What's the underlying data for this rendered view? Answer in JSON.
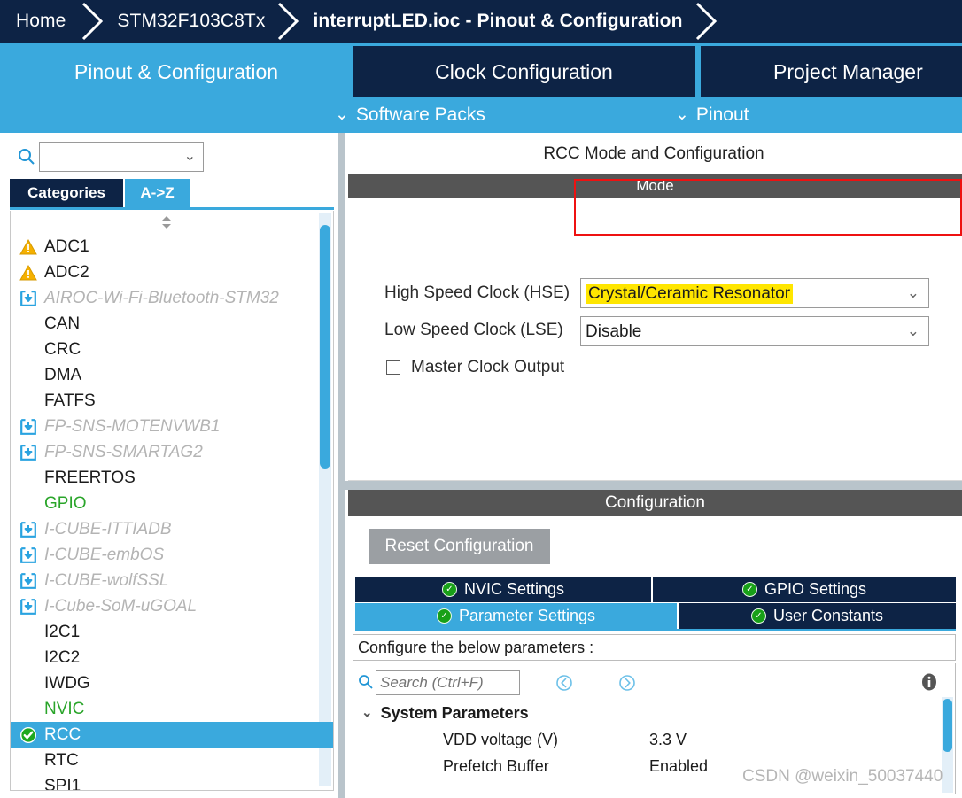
{
  "breadcrumb": {
    "items": [
      {
        "label": "Home",
        "active": false
      },
      {
        "label": "STM32F103C8Tx",
        "active": false
      },
      {
        "label": "interruptLED.ioc - Pinout & Configuration",
        "active": true
      }
    ]
  },
  "main_tabs": [
    {
      "label": "Pinout & Configuration",
      "active": true
    },
    {
      "label": "Clock Configuration",
      "active": false
    },
    {
      "label": "Project Manager",
      "active": false
    }
  ],
  "sub_toolbar": {
    "software_packs": "Software Packs",
    "pinout": "Pinout",
    "chevron_glyph": "⌄"
  },
  "left_panel": {
    "search": {
      "value": "",
      "placeholder": ""
    },
    "tabs": [
      {
        "label": "Categories",
        "active": false
      },
      {
        "label": "A->Z",
        "active": true
      }
    ],
    "items": [
      {
        "label": "ADC1",
        "icon": "warning-icon",
        "state": "warning"
      },
      {
        "label": "ADC2",
        "icon": "warning-icon",
        "state": "warning"
      },
      {
        "label": "AIROC-Wi-Fi-Bluetooth-STM32",
        "icon": "download-icon",
        "state": "dim"
      },
      {
        "label": "CAN",
        "icon": "none",
        "state": "normal"
      },
      {
        "label": "CRC",
        "icon": "none",
        "state": "normal"
      },
      {
        "label": "DMA",
        "icon": "none",
        "state": "normal"
      },
      {
        "label": "FATFS",
        "icon": "none",
        "state": "normal"
      },
      {
        "label": "FP-SNS-MOTENVWB1",
        "icon": "download-icon",
        "state": "dim"
      },
      {
        "label": "FP-SNS-SMARTAG2",
        "icon": "download-icon",
        "state": "dim"
      },
      {
        "label": "FREERTOS",
        "icon": "none",
        "state": "normal"
      },
      {
        "label": "GPIO",
        "icon": "none",
        "state": "green"
      },
      {
        "label": "I-CUBE-ITTIADB",
        "icon": "download-icon",
        "state": "dim"
      },
      {
        "label": "I-CUBE-embOS",
        "icon": "download-icon",
        "state": "dim"
      },
      {
        "label": "I-CUBE-wolfSSL",
        "icon": "download-icon",
        "state": "dim"
      },
      {
        "label": "I-Cube-SoM-uGOAL",
        "icon": "download-icon",
        "state": "dim"
      },
      {
        "label": "I2C1",
        "icon": "none",
        "state": "normal"
      },
      {
        "label": "I2C2",
        "icon": "none",
        "state": "normal"
      },
      {
        "label": "IWDG",
        "icon": "none",
        "state": "normal"
      },
      {
        "label": "NVIC",
        "icon": "none",
        "state": "green"
      },
      {
        "label": "RCC",
        "icon": "check-icon",
        "state": "selected"
      },
      {
        "label": "RTC",
        "icon": "none",
        "state": "normal"
      },
      {
        "label": "SPI1",
        "icon": "none",
        "state": "normal"
      }
    ]
  },
  "right_panel": {
    "page_title": "RCC Mode and Configuration",
    "mode": {
      "band_label": "Mode",
      "fields": [
        {
          "label": "High Speed Clock (HSE)",
          "value": "Crystal/Ceramic Resonator",
          "highlighted": true
        },
        {
          "label": "Low Speed Clock (LSE)",
          "value": "Disable",
          "highlighted": false
        }
      ],
      "checkbox": {
        "label": "Master Clock Output",
        "checked": false
      },
      "chevron_glyph": "⌄"
    },
    "configuration": {
      "band_label": "Configuration",
      "reset_button": "Reset Configuration",
      "tabs": [
        {
          "label": "NVIC Settings",
          "active": false
        },
        {
          "label": "GPIO Settings",
          "active": false
        },
        {
          "label": "Parameter Settings",
          "active": true
        },
        {
          "label": "User Constants",
          "active": false
        }
      ],
      "note": "Configure the below parameters :",
      "search": {
        "value": "",
        "placeholder": "Search (Ctrl+F)"
      },
      "group": {
        "label": "System Parameters",
        "expanded": true
      },
      "rows": [
        {
          "key": "VDD voltage (V)",
          "value": "3.3 V"
        },
        {
          "key": "Prefetch Buffer",
          "value": "Enabled"
        }
      ]
    }
  },
  "watermark": "CSDN @weixin_50037440",
  "colors": {
    "navy": "#0d2345",
    "accent_blue": "#3aa9dd",
    "band_gray": "#555555",
    "highlight_yellow": "#ffe600",
    "annotation_red": "#ee1111",
    "green": "#2aa52a"
  }
}
